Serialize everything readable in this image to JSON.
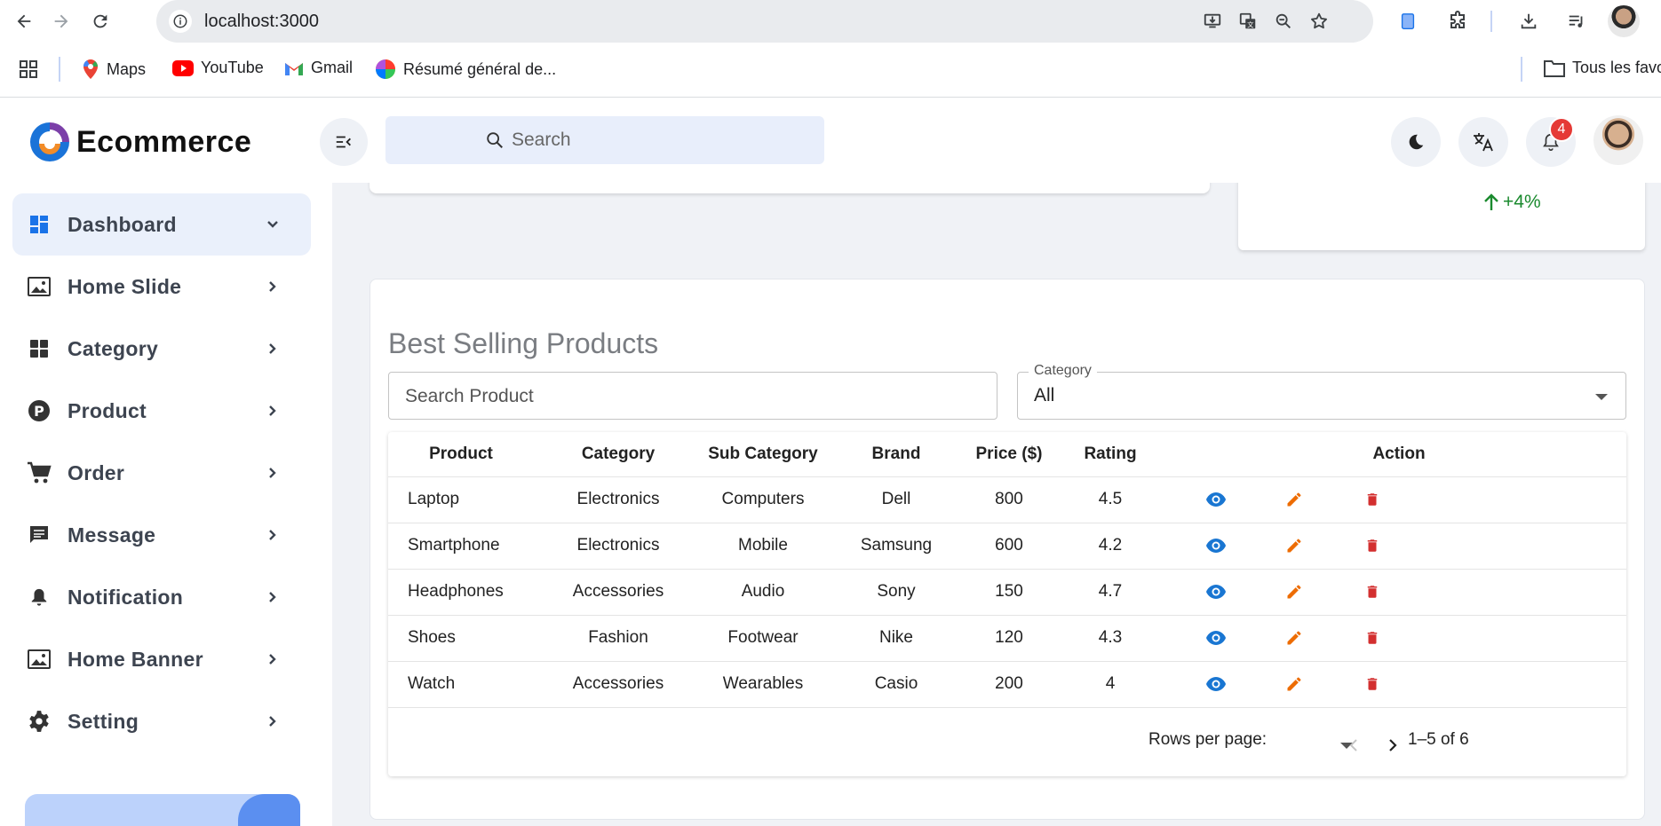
{
  "browser": {
    "url": "localhost:3000",
    "bookmarks": [
      {
        "label": "Maps"
      },
      {
        "label": "YouTube"
      },
      {
        "label": "Gmail"
      },
      {
        "label": "Résumé général de..."
      }
    ],
    "all_favorites_label": "Tous les favo"
  },
  "header": {
    "logo_text": "Ecommerce",
    "search_placeholder": "Search",
    "notification_count": "4"
  },
  "sidebar": {
    "items": [
      {
        "label": "Dashboard",
        "icon": "dashboard-icon",
        "active": true
      },
      {
        "label": "Home Slide",
        "icon": "image-icon"
      },
      {
        "label": "Category",
        "icon": "category-icon"
      },
      {
        "label": "Product",
        "icon": "product-icon"
      },
      {
        "label": "Order",
        "icon": "cart-icon"
      },
      {
        "label": "Message",
        "icon": "message-icon"
      },
      {
        "label": "Notification",
        "icon": "bell-icon"
      },
      {
        "label": "Home Banner",
        "icon": "image-icon"
      },
      {
        "label": "Setting",
        "icon": "gear-icon"
      }
    ]
  },
  "stats": {
    "trend_value": "+4%"
  },
  "products": {
    "title": "Best Selling Products",
    "search_placeholder": "Search Product",
    "category_label": "Category",
    "category_value": "All",
    "columns": [
      "Product",
      "Category",
      "Sub Category",
      "Brand",
      "Price ($)",
      "Rating",
      "Action"
    ],
    "rows": [
      [
        "Laptop",
        "Electronics",
        "Computers",
        "Dell",
        "800",
        "4.5"
      ],
      [
        "Smartphone",
        "Electronics",
        "Mobile",
        "Samsung",
        "600",
        "4.2"
      ],
      [
        "Headphones",
        "Accessories",
        "Audio",
        "Sony",
        "150",
        "4.7"
      ],
      [
        "Shoes",
        "Fashion",
        "Footwear",
        "Nike",
        "120",
        "4.3"
      ],
      [
        "Watch",
        "Accessories",
        "Wearables",
        "Casio",
        "200",
        "4"
      ]
    ],
    "rows_per_page_label": "Rows per page:",
    "range_label": "1–5 of 6"
  },
  "colors": {
    "accent": "#1976d2",
    "edit": "#ed6c02",
    "delete": "#d32f2f",
    "trend": "#1a8a2e",
    "badge": "#e53935"
  }
}
